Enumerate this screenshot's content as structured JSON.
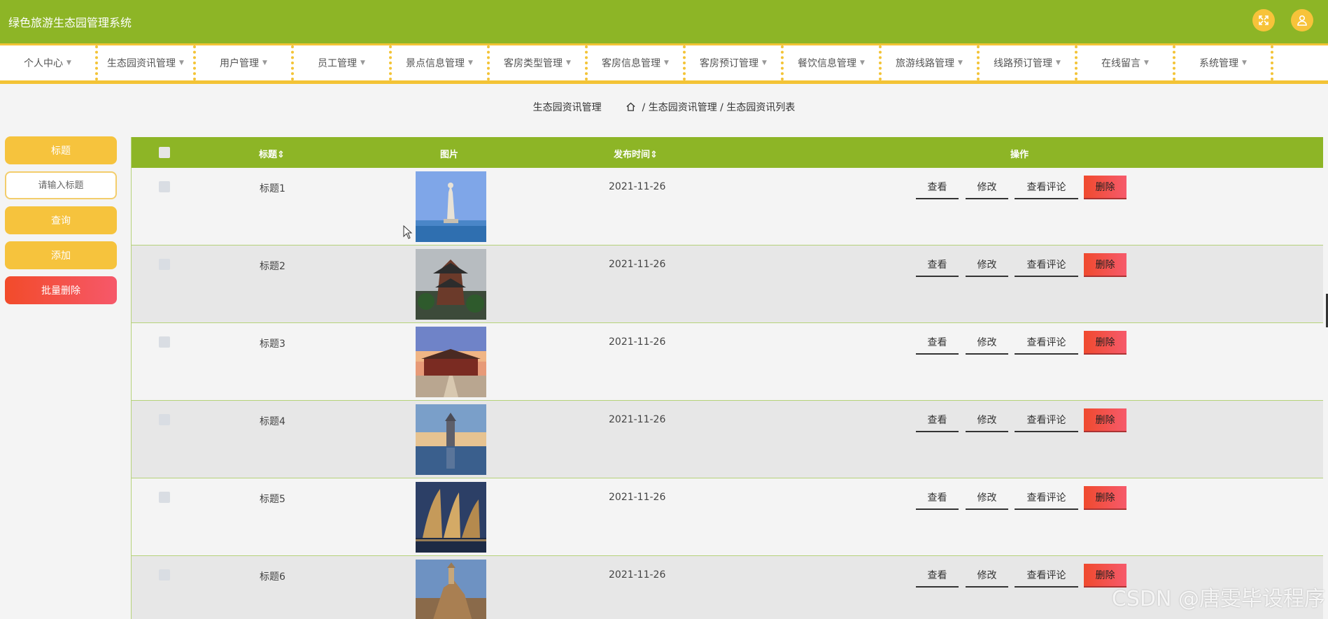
{
  "app": {
    "title": "绿色旅游生态园管理系统"
  },
  "topbar": {
    "fullscreen_icon": "fullscreen-icon",
    "user_icon": "user-icon",
    "icon_bg": "#f7c33a",
    "bg": "#8db526"
  },
  "nav": {
    "items": [
      {
        "label": "个人中心"
      },
      {
        "label": "生态园资讯管理"
      },
      {
        "label": "用户管理"
      },
      {
        "label": "员工管理"
      },
      {
        "label": "景点信息管理"
      },
      {
        "label": "客房类型管理"
      },
      {
        "label": "客房信息管理"
      },
      {
        "label": "客房预订管理"
      },
      {
        "label": "餐饮信息管理"
      },
      {
        "label": "旅游线路管理"
      },
      {
        "label": "线路预订管理"
      },
      {
        "label": "在线留言"
      },
      {
        "label": "系统管理"
      }
    ]
  },
  "breadcrumb": {
    "page_title": "生态园资讯管理",
    "home_icon": "home-icon",
    "level1": "/ 生态园资讯管理",
    "level2": "/ 生态园资讯列表"
  },
  "sidebar": {
    "field_label": "标题",
    "search_placeholder": "请输入标题",
    "search_button": "查询",
    "add_button": "添加",
    "batch_delete_button": "批量删除"
  },
  "table": {
    "headers": {
      "title": "标题",
      "image": "图片",
      "date": "发布时间",
      "actions": "操作"
    },
    "sort_icon": "sort-icon",
    "action_labels": {
      "view": "查看",
      "edit": "修改",
      "comments": "查看评论",
      "delete": "删除"
    },
    "rows": [
      {
        "title": "标题1",
        "date": "2021-11-26",
        "image": "guanyin-statue-photo"
      },
      {
        "title": "标题2",
        "date": "2021-11-26",
        "image": "pavilion-tower-photo"
      },
      {
        "title": "标题3",
        "date": "2021-11-26",
        "image": "palace-gate-sunset-photo"
      },
      {
        "title": "标题4",
        "date": "2021-11-26",
        "image": "pagoda-lake-photo"
      },
      {
        "title": "标题5",
        "date": "2021-11-26",
        "image": "sail-buildings-night-photo"
      },
      {
        "title": "标题6",
        "date": "2021-11-26",
        "image": "cliff-tower-photo"
      }
    ]
  },
  "watermark": "CSDN @唐雯毕设程序",
  "colors": {
    "primary_green": "#8db526",
    "accent_yellow": "#f6c33d",
    "danger_red": "#f24b2a"
  }
}
